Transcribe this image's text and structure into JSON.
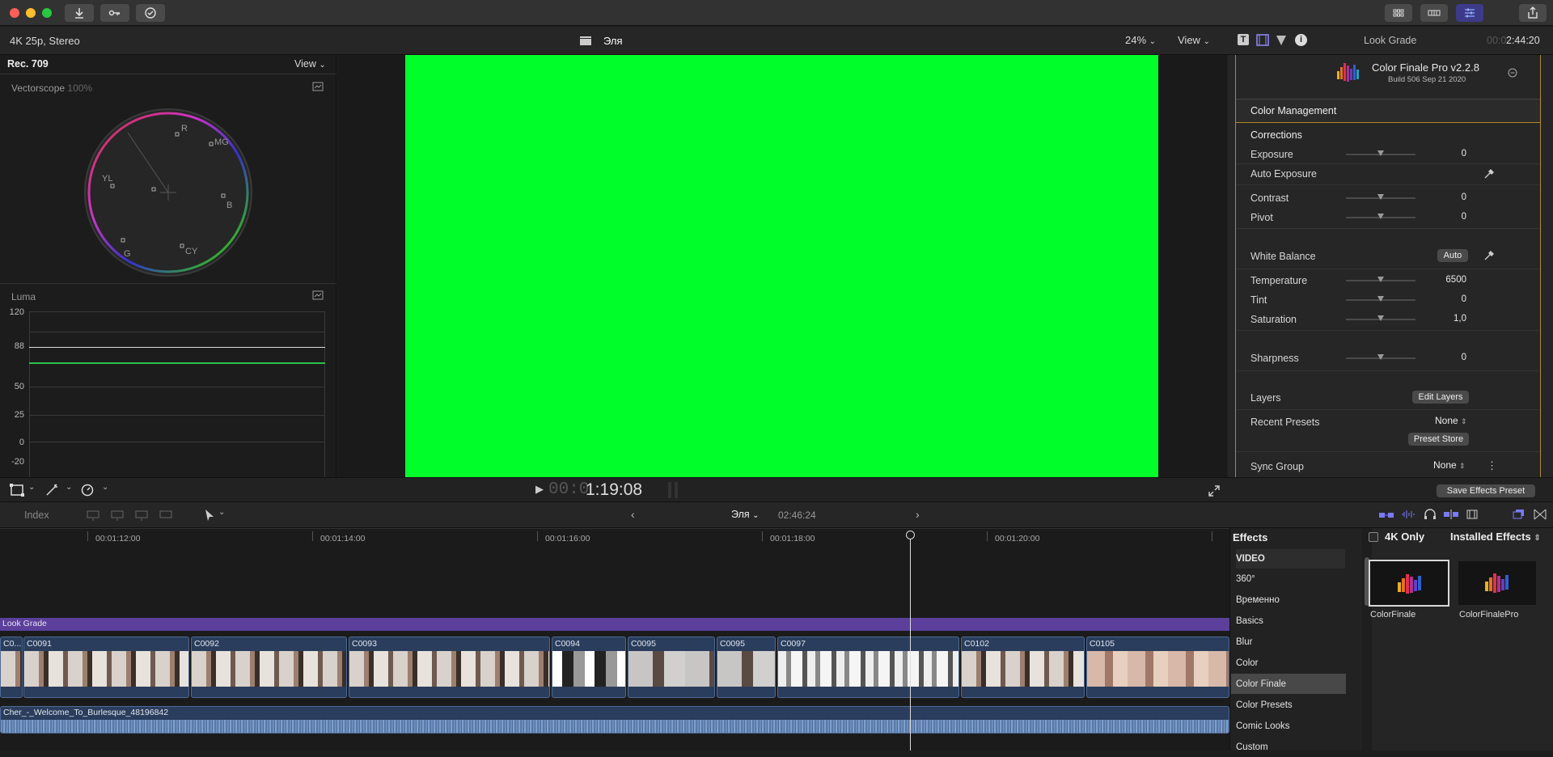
{
  "infobar": {
    "format": "4K 25p, Stereo",
    "project": "Эля",
    "zoom": "24%",
    "view": "View"
  },
  "scopes": {
    "colorspace": "Rec. 709",
    "view": "View",
    "vectorscope_label": "Vectorscope",
    "vectorscope_pct": "100%",
    "targets": [
      "R",
      "MG",
      "B",
      "CY",
      "G",
      "YL"
    ],
    "luma_label": "Luma",
    "luma_ticks": [
      "120",
      "88",
      "50",
      "25",
      "0",
      "-20"
    ]
  },
  "viewer": {
    "timecode_dim": "00:0",
    "timecode": "1:19:08",
    "frame_color": "#00ff2a"
  },
  "inspector": {
    "title": "Look Grade",
    "timecode_dim": "00:0",
    "timecode": "2:44:20",
    "plugin_name": "Color Finale Pro v2.2.8",
    "plugin_build": "Build 506 Sep 21 2020",
    "color_management": "Color Management",
    "corrections": "Corrections",
    "exposure": {
      "label": "Exposure",
      "value": "0"
    },
    "auto_exposure": "Auto Exposure",
    "contrast": {
      "label": "Contrast",
      "value": "0"
    },
    "pivot": {
      "label": "Pivot",
      "value": "0"
    },
    "white_balance": "White Balance",
    "auto_btn": "Auto",
    "temperature": {
      "label": "Temperature",
      "value": "6500"
    },
    "tint": {
      "label": "Tint",
      "value": "0"
    },
    "saturation": {
      "label": "Saturation",
      "value": "1,0"
    },
    "sharpness": {
      "label": "Sharpness",
      "value": "0"
    },
    "layers": "Layers",
    "edit_layers": "Edit Layers",
    "recent_presets": "Recent Presets",
    "recent_value": "None",
    "preset_store": "Preset Store",
    "sync_group": "Sync Group",
    "sync_value": "None",
    "save_preset": "Save Effects Preset"
  },
  "timeline": {
    "index": "Index",
    "project": "Эля",
    "duration": "02:46:24",
    "ruler": [
      "00:01:12:00",
      "00:01:14:00",
      "00:01:16:00",
      "00:01:18:00",
      "00:01:20:00"
    ],
    "adjustment_clip": "Look Grade",
    "clips": [
      "C0...",
      "C0091",
      "C0092",
      "C0093",
      "C0094",
      "C0095",
      "C0095",
      "C0097",
      "C0102",
      "C0105"
    ],
    "audio_clip": "Cher_-_Welcome_To_Burlesque_48196842"
  },
  "effects": {
    "title": "Effects",
    "filter": "4K Only",
    "installed": "Installed Effects",
    "categories": [
      "VIDEO",
      "360°",
      "Временно",
      "Basics",
      "Blur",
      "Color",
      "Color Finale",
      "Color Presets",
      "Comic Looks",
      "Custom"
    ],
    "selected": "Color Finale",
    "items": [
      "ColorFinale",
      "ColorFinalePro"
    ]
  },
  "colors": {
    "accent": "#5a4bd6",
    "adjustment": "#5b3f9a",
    "clip": "#2a3d5c",
    "audio": "#5a7aa8"
  }
}
